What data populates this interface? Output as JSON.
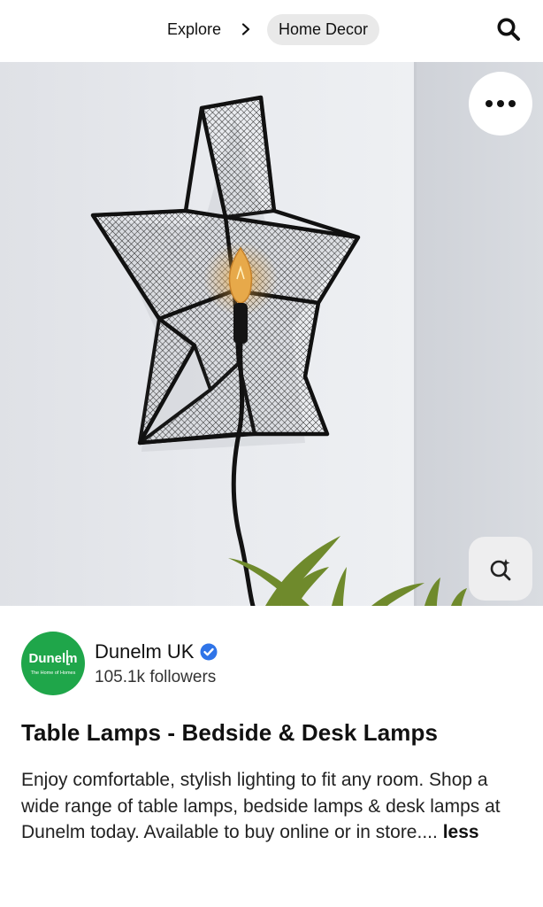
{
  "header": {
    "breadcrumb": [
      {
        "label": "Explore"
      },
      {
        "label": "Home Decor"
      }
    ],
    "icons": {
      "separator": "chevron-right-icon",
      "search": "search-icon"
    }
  },
  "pin": {
    "image_alt": "Black mesh star wall lamp with bulb",
    "buttons": {
      "more": "more-options-icon",
      "visual_search": "visual-search-icon"
    }
  },
  "creator": {
    "logo_text": "Dunelm",
    "logo_tagline": "The Home of Homes",
    "name": "Dunelm UK",
    "verified": true,
    "followers": "105.1k followers",
    "brand_color": "#1fa64a"
  },
  "content": {
    "title": "Table Lamps - Bedside & Desk Lamps",
    "description": "Enjoy comfortable, stylish lighting to fit any room. Shop a wide range of table lamps, bedside lamps & desk lamps at Dunelm today. Available to buy online or in store....",
    "less_label": "less"
  }
}
